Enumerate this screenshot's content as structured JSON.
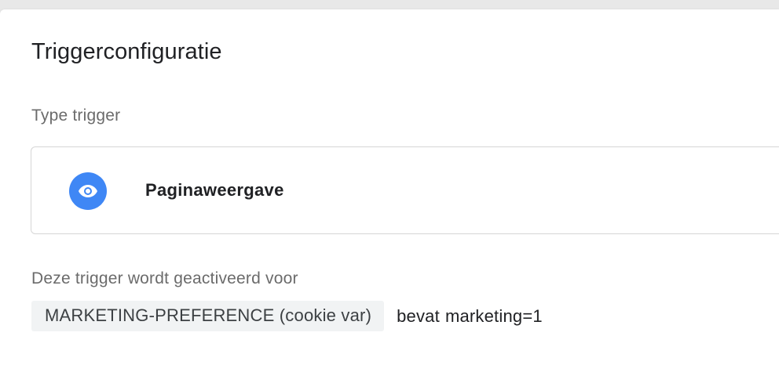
{
  "panel": {
    "title": "Triggerconfiguratie"
  },
  "trigger_type": {
    "label": "Type trigger",
    "name": "Paginaweergave",
    "icon": "eye-icon",
    "icon_color": "#3f87f5"
  },
  "firing": {
    "label": "Deze trigger wordt geactiveerd voor",
    "variable": "MARKETING-PREFERENCE (cookie var)",
    "operator": "bevat",
    "value": "marketing=1"
  }
}
